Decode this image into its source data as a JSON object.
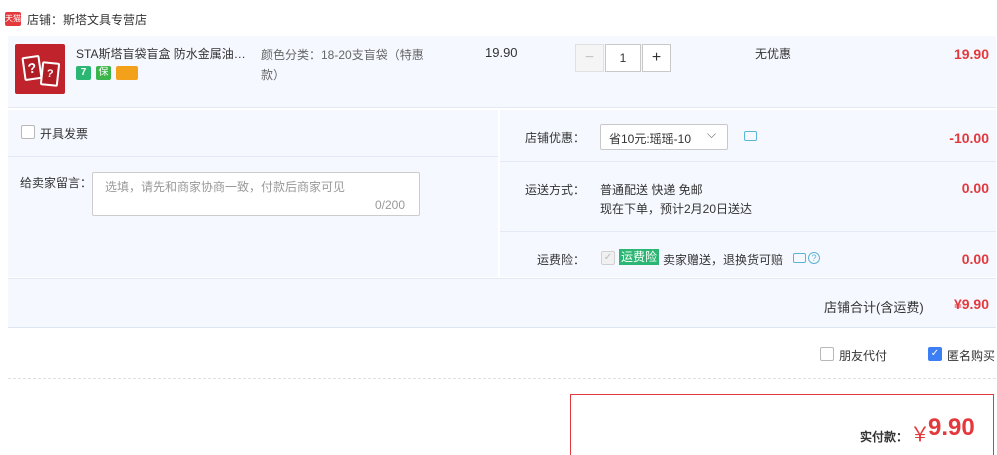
{
  "shop": {
    "badge": "天猫",
    "name": "店铺：斯塔文具专营店"
  },
  "item": {
    "title": "STA斯塔盲袋盲盒 防水金属油墨…",
    "thumb_glyphs": [
      "?",
      "?"
    ],
    "badges": [
      "7",
      "保",
      ""
    ],
    "sku": "颜色分类：18-20支盲袋（特惠款）",
    "unit_price": "19.90",
    "quantity": "1",
    "minus": "−",
    "plus": "+",
    "promo": "无优惠",
    "subtotal": "19.90"
  },
  "options": {
    "invoice_label": "开具发票",
    "message_label": "给卖家留言：",
    "message_placeholder": "选填，请先和商家协商一致，付款后商家可见",
    "message_count": "0/200",
    "coupon_label": "店铺优惠：",
    "coupon_value": "省10元:瑶瑶-10",
    "coupon_caret": "⌵",
    "coupon_amount": "-10.00",
    "shipping_label": "运送方式：",
    "shipping_line1": "普通配送 快递 免邮",
    "shipping_line2": "现在下单，预计2月20日送达",
    "shipping_amount": "0.00",
    "insurance_label": "运费险：",
    "insurance_badge": "运费险",
    "insurance_text": "卖家赠送，退换货可赔",
    "insurance_amount": "0.00",
    "help_glyph": "?",
    "check_glyph": "✓"
  },
  "total": {
    "label": "店铺合计(含运费)",
    "amount": "¥9.90"
  },
  "checkout": {
    "friend_pay": "朋友代付",
    "anonymous": "匿名购买",
    "pay_label": "实付款：",
    "pay_currency": "￥",
    "pay_amount": "9.90"
  },
  "colors": {
    "accent": "#e4393c",
    "panel": "#f5f8ff",
    "check": "#3c7ef3",
    "green": "#2bb673"
  }
}
